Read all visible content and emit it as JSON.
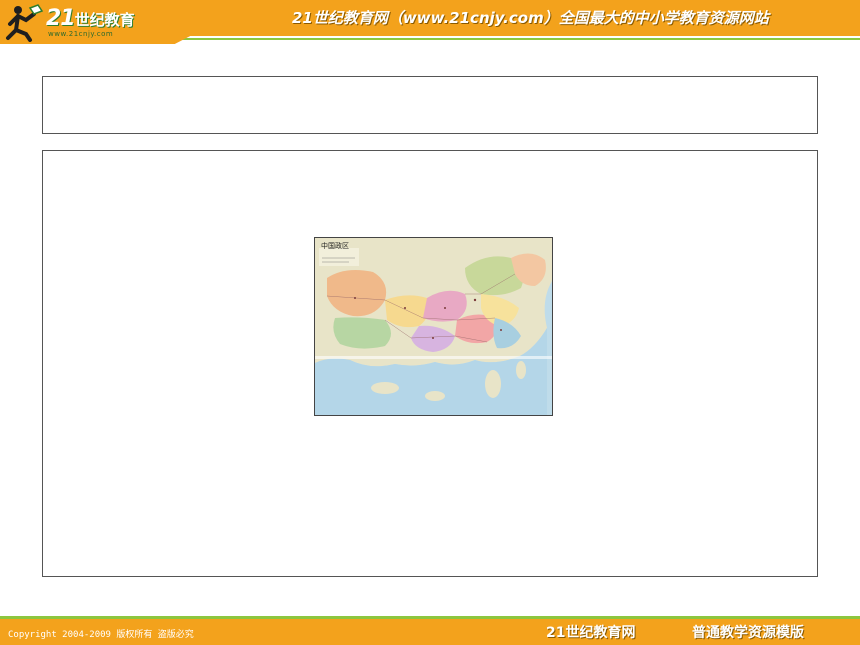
{
  "header": {
    "logo_text": "21",
    "logo_text_cn": "世纪教育",
    "logo_url": "www.21cnjy.com",
    "title": "21世纪教育网（www.21cnjy.com）全国最大的中小学教育资源网站"
  },
  "slide": {
    "title_text": "",
    "content_text": ""
  },
  "map": {
    "title": "中国政区"
  },
  "footer": {
    "copyright": "Copyright 2004-2009 版权所有 盗版必究",
    "brand": "21世纪教育网",
    "tagline": "普通教学资源模版"
  },
  "colors": {
    "band": "#F3A21C",
    "accent_green": "#8DC63F"
  },
  "icons": {
    "logo": "running-figure-book-icon"
  }
}
